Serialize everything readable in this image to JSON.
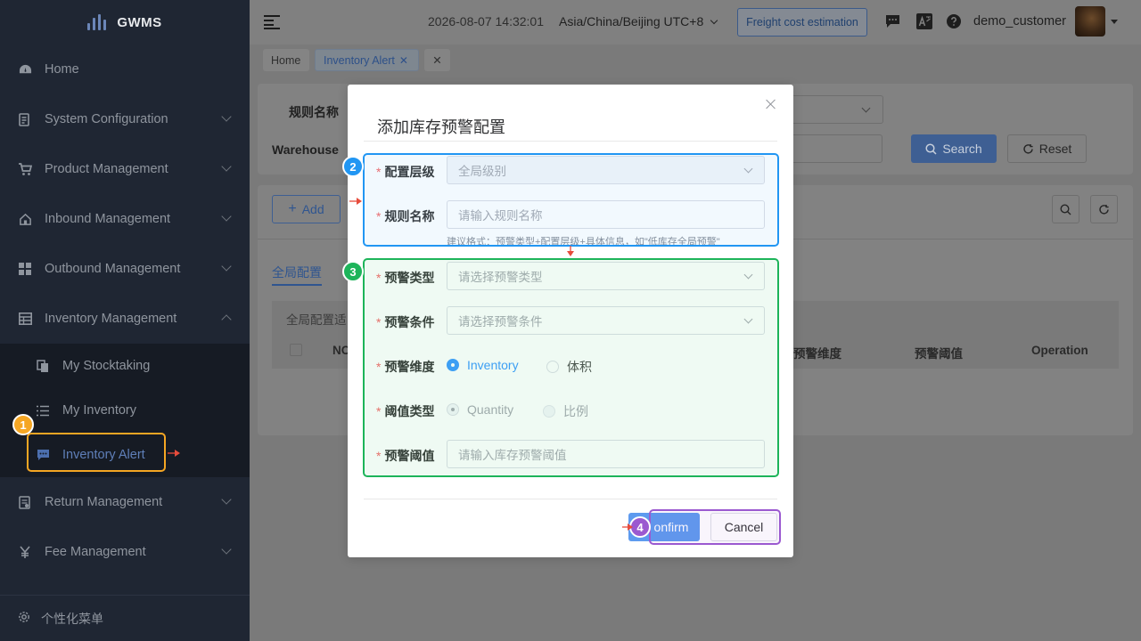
{
  "colors": {
    "sidebar_bg": "#1f2633",
    "accent_blue": "#409eff",
    "annotation_orange": "#f5a623",
    "annotation_blue": "#2196f3",
    "annotation_green": "#1db45a",
    "annotation_purple": "#9b59d0",
    "required_red": "#f56c6c"
  },
  "app": {
    "name": "GWMS"
  },
  "sidebar": {
    "menu": [
      {
        "label": "Home",
        "icon": "dashboard-icon"
      },
      {
        "label": "System Configuration",
        "icon": "config-icon"
      },
      {
        "label": "Product Management",
        "icon": "cart-icon"
      },
      {
        "label": "Inbound Management",
        "icon": "home-icon"
      },
      {
        "label": "Outbound Management",
        "icon": "grid-icon"
      },
      {
        "label": "Inventory Management",
        "icon": "table-icon"
      }
    ],
    "submenu": [
      {
        "label": "My Stocktaking",
        "icon": "copy-icon"
      },
      {
        "label": "My Inventory",
        "icon": "list-icon"
      },
      {
        "label": "Inventory Alert",
        "icon": "chat-icon"
      }
    ],
    "menu_after": [
      {
        "label": "Return Management",
        "icon": "document-icon"
      },
      {
        "label": "Fee Management",
        "icon": "yen-icon"
      }
    ],
    "footer": {
      "label": "个性化菜单",
      "icon": "gear-icon"
    }
  },
  "header": {
    "datetime": "2026-08-07 14:32:01",
    "timezone": "Asia/China/Beijing UTC+8",
    "freight_button": "Freight cost estimation",
    "username": "demo_customer"
  },
  "tabs": {
    "home": "Home",
    "inventory_alert": "Inventory Alert"
  },
  "background": {
    "rule_name_label": "规则名称",
    "warehouse_label": "Warehouse",
    "search_button": "Search",
    "reset_button": "Reset",
    "add_button": "Add",
    "tab_global": "全局配置",
    "global_note": "全局配置适",
    "col_no": "NO",
    "col_dimension": "预警维度",
    "col_threshold": "预警阈值",
    "col_operation": "Operation"
  },
  "modal": {
    "title": "添加库存预警配置",
    "fields": {
      "level": {
        "label": "配置层级",
        "value": "全局级别"
      },
      "rule_name": {
        "label": "规则名称",
        "placeholder": "请输入规则名称",
        "hint": "建议格式：预警类型+配置层级+具体信息，如\"低库存全局预警\""
      },
      "alert_type": {
        "label": "预警类型",
        "placeholder": "请选择预警类型"
      },
      "alert_condition": {
        "label": "预警条件",
        "placeholder": "请选择预警条件"
      },
      "dimension": {
        "label": "预警维度",
        "option_a": "Inventory",
        "option_b": "体积",
        "selected": "Inventory"
      },
      "threshold_type": {
        "label": "阈值类型",
        "option_a": "Quantity",
        "option_b": "比例",
        "selected": "Quantity"
      },
      "threshold": {
        "label": "预警阈值",
        "placeholder": "请输入库存预警阈值"
      }
    },
    "confirm_button": "Confirm",
    "confirm_visible": "onfirm",
    "cancel_button": "Cancel",
    "required_mark": "*"
  },
  "annotations": [
    {
      "number": "1"
    },
    {
      "number": "2"
    },
    {
      "number": "3"
    },
    {
      "number": "4"
    }
  ]
}
